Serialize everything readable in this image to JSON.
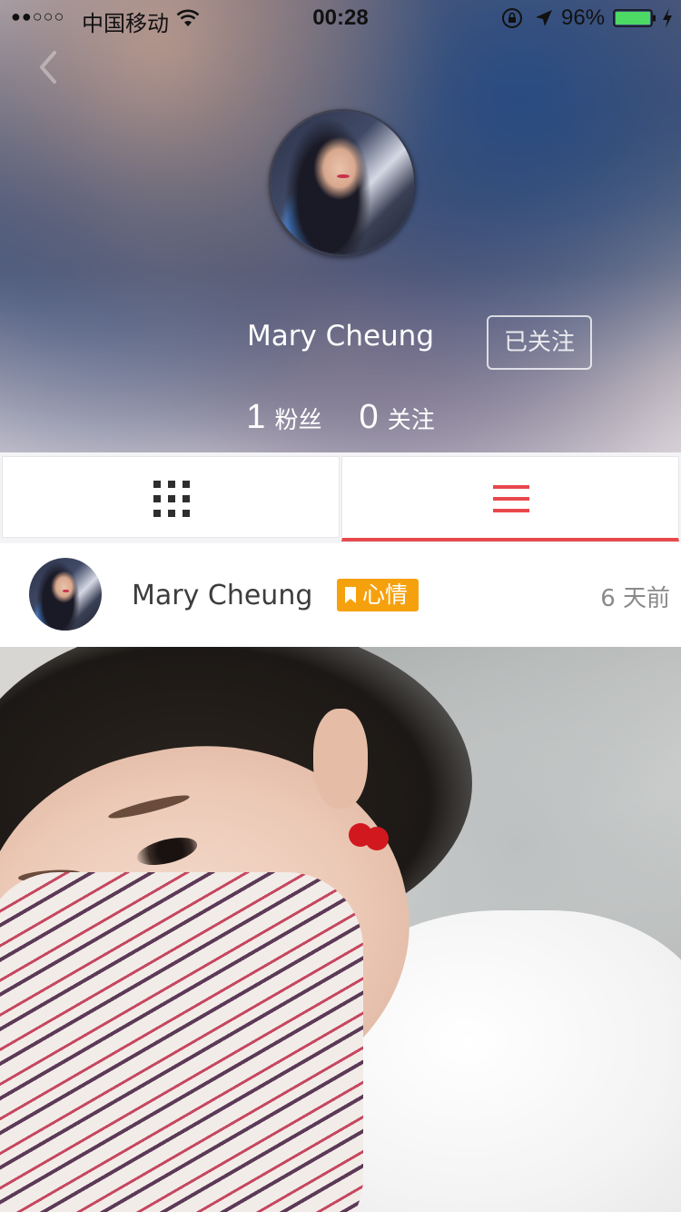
{
  "status_bar": {
    "signal": "●●○○○",
    "carrier": "中国移动",
    "time": "00:28",
    "battery_percent": "96%"
  },
  "profile": {
    "name": "Mary Cheung",
    "follow_button_label": "已关注",
    "followers_count": "1",
    "followers_label": "粉丝",
    "following_count": "0",
    "following_label": "关注"
  },
  "tabs": {
    "items": [
      {
        "icon": "grid-icon",
        "selected": false
      },
      {
        "icon": "list-icon",
        "selected": true
      }
    ],
    "accent_color": "#e8484b"
  },
  "post": {
    "author": "Mary Cheung",
    "tag_label": "心情",
    "tag_color": "#f5a10e",
    "time_ago": "6 天前"
  }
}
